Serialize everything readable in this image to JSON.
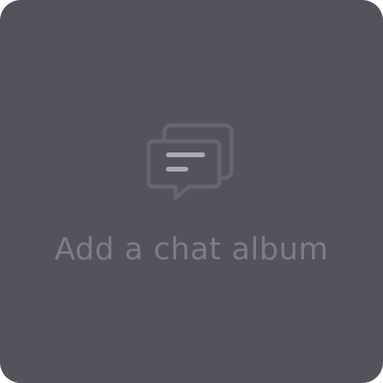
{
  "card": {
    "label": "Add a chat album",
    "icon": "chat-bubbles-icon",
    "background": "#53545b",
    "text_color": "#7c7d85",
    "icon_color": "#66676e",
    "lines_color": "#a9aab2"
  }
}
